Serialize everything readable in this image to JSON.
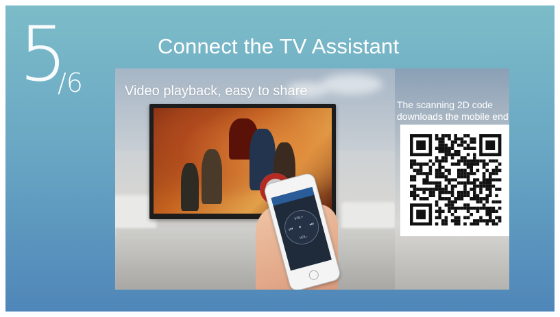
{
  "step": {
    "current": "5",
    "total": "/6"
  },
  "title": "Connect the TV Assistant",
  "promo": {
    "caption": "Video playback, easy to share",
    "qr_caption_line1": "The scanning 2D code",
    "qr_caption_line2": "downloads the mobile end"
  },
  "phone_remote": {
    "vol_up": "VOL+",
    "vol_down": "VOL-"
  },
  "colors": {
    "background_top": "#7cbcc8",
    "background_bottom": "#4f86b9",
    "text": "#ffffff"
  }
}
